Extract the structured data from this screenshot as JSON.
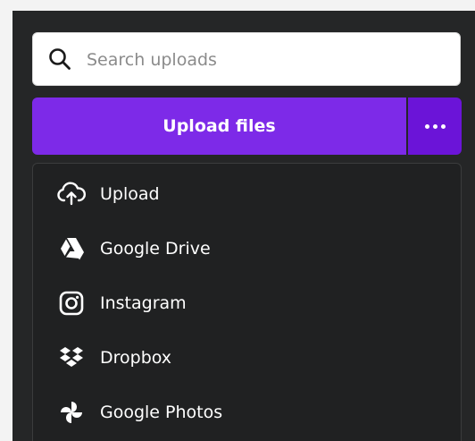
{
  "search": {
    "placeholder": "Search uploads",
    "value": ""
  },
  "upload": {
    "button_label": "Upload files",
    "more_icon": "more-horizontal-icon",
    "accent_color": "#7d2ae8"
  },
  "menu": {
    "items": [
      {
        "label": "Upload",
        "icon": "cloud-upload-icon"
      },
      {
        "label": "Google Drive",
        "icon": "google-drive-icon"
      },
      {
        "label": "Instagram",
        "icon": "instagram-icon"
      },
      {
        "label": "Dropbox",
        "icon": "dropbox-icon"
      },
      {
        "label": "Google Photos",
        "icon": "google-photos-icon"
      }
    ]
  }
}
